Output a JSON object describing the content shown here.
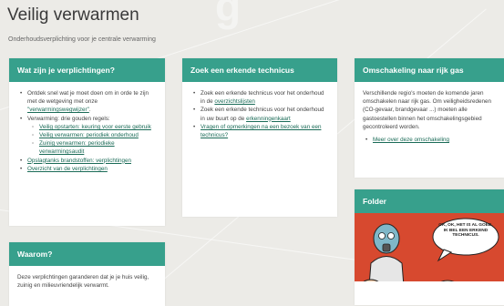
{
  "header": {
    "title": "Veilig verwarmen",
    "subtitle": "Onderhoudsverplichting voor je centrale verwarming"
  },
  "cards": {
    "verplichtingen": {
      "title": "Wat zijn je verplichtingen?",
      "item1_text": "Ontdek snel wat je moet doen om in orde te zijn met de wetgeving met onze ",
      "item1_link": "\"verwarmingswegwijzer\"",
      "item1_end": ".",
      "item2_text": "Verwarming: drie gouden regels:",
      "sub1": "Veilig opstarten: keuring voor eerste gebruik",
      "sub2": "Veilig verwarmen: periodiek onderhoud",
      "sub3": "Zuinig verwarmen: periodieke verwarmingsaudit",
      "item3": "Opslagtanks brandstoffen: verplichtingen",
      "item4": "Overzicht van de verplichtingen"
    },
    "technicus": {
      "title": "Zoek een erkende technicus",
      "item1_text": "Zoek een erkende technicus voor het onderhoud in de ",
      "item1_link": "overzichtslijsten",
      "item2_text": "Zoek een erkende technicus voor het onderhoud in uw buurt op de ",
      "item2_link": "erkenningenkaart",
      "item3": "Vragen of opmerkingen na een bezoek van een technicus?"
    },
    "omschakeling": {
      "title": "Omschakeling naar rijk gas",
      "body": "Verschillende regio's moeten de komende jaren omschakelen naar rijk gas. Om veiligheidsredenen (CO-gevaar, brandgevaar ...) moeten alle gastoestellen binnen het omschakelingsgebied gecontroleerd worden.",
      "link": "Meer over deze omschakeling"
    },
    "waarom": {
      "title": "Waarom?",
      "body": "Deze verplichtingen garanderen dat je je huis veilig, zuinig en milieuvriendelijk verwarmt."
    },
    "folder": {
      "title": "Folder",
      "speech": "OK, OK, HET IS AL GOED. IK BEL EEN ERKEND TECHNICUS."
    }
  },
  "colors": {
    "accent": "#37a08c",
    "link": "#1a6b57",
    "background": "#ecebe7"
  }
}
